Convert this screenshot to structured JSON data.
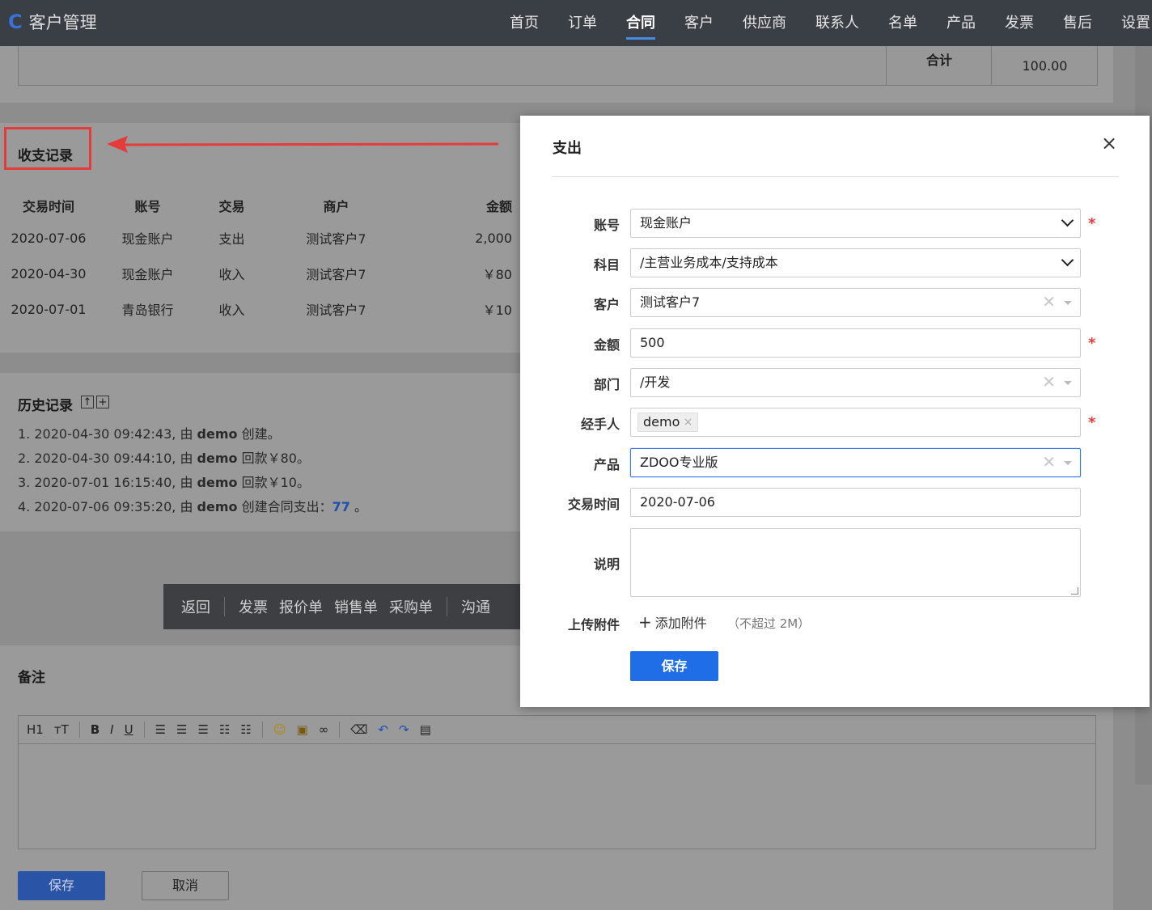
{
  "app": {
    "title": "客户管理",
    "logo_glyph": "C"
  },
  "nav": {
    "items": [
      "首页",
      "订单",
      "合同",
      "客户",
      "供应商",
      "联系人",
      "名单",
      "产品",
      "发票",
      "售后",
      "设置"
    ],
    "active_index": 2
  },
  "summary": {
    "label": "合计",
    "value": "100.00"
  },
  "records": {
    "title": "收支记录",
    "headers": [
      "交易时间",
      "账号",
      "交易",
      "商户",
      "金额"
    ],
    "rows": [
      [
        "2020-07-06",
        "现金账户",
        "支出",
        "测试客户7",
        "2,000"
      ],
      [
        "2020-04-30",
        "现金账户",
        "收入",
        "测试客户7",
        "￥80"
      ],
      [
        "2020-07-01",
        "青岛银行",
        "收入",
        "测试客户7",
        "￥10"
      ]
    ]
  },
  "history": {
    "title": "历史记录",
    "items": [
      {
        "prefix": "1. 2020-04-30 09:42:43, 由 ",
        "user": "demo",
        "suffix": " 创建。",
        "link": "",
        "end": ""
      },
      {
        "prefix": "2. 2020-04-30 09:44:10, 由 ",
        "user": "demo",
        "suffix": " 回款￥80。",
        "link": "",
        "end": ""
      },
      {
        "prefix": "3. 2020-07-01 16:15:40, 由 ",
        "user": "demo",
        "suffix": " 回款￥10。",
        "link": "",
        "end": ""
      },
      {
        "prefix": "4. 2020-07-06 09:35:20, 由 ",
        "user": "demo",
        "suffix": " 创建合同支出：",
        "link": "77",
        "end": " 。"
      }
    ]
  },
  "actionbar": {
    "back": "返回",
    "items": [
      "发票",
      "报价单",
      "销售单",
      "采购单"
    ],
    "more": "沟通"
  },
  "notes": {
    "title": "备注"
  },
  "editor_toolbar": [
    "H1",
    "тT",
    "B",
    "I",
    "U"
  ],
  "bottom": {
    "save": "保存",
    "cancel": "取消"
  },
  "modal": {
    "title": "支出",
    "close": "×",
    "fields": {
      "account": {
        "label": "账号",
        "value": "现金账户"
      },
      "subject": {
        "label": "科目",
        "value": "/主营业务成本/支持成本"
      },
      "customer": {
        "label": "客户",
        "value": "测试客户7"
      },
      "amount": {
        "label": "金额",
        "value": "500"
      },
      "dept": {
        "label": "部门",
        "value": "/开发"
      },
      "handler": {
        "label": "经手人",
        "tag": "demo"
      },
      "product": {
        "label": "产品",
        "value": "ZDOO专业版"
      },
      "date": {
        "label": "交易时间",
        "value": "2020-07-06"
      },
      "desc": {
        "label": "说明",
        "value": ""
      },
      "attach": {
        "label": "上传附件",
        "add": "添加附件",
        "hint": "（不超过 2M）"
      }
    },
    "save": "保存",
    "required_mark": "*"
  },
  "colors": {
    "accent": "#1f6ee8",
    "required": "#e53b3b",
    "annotation": "#e53b3b",
    "nav_bg": "#3a3f46"
  }
}
